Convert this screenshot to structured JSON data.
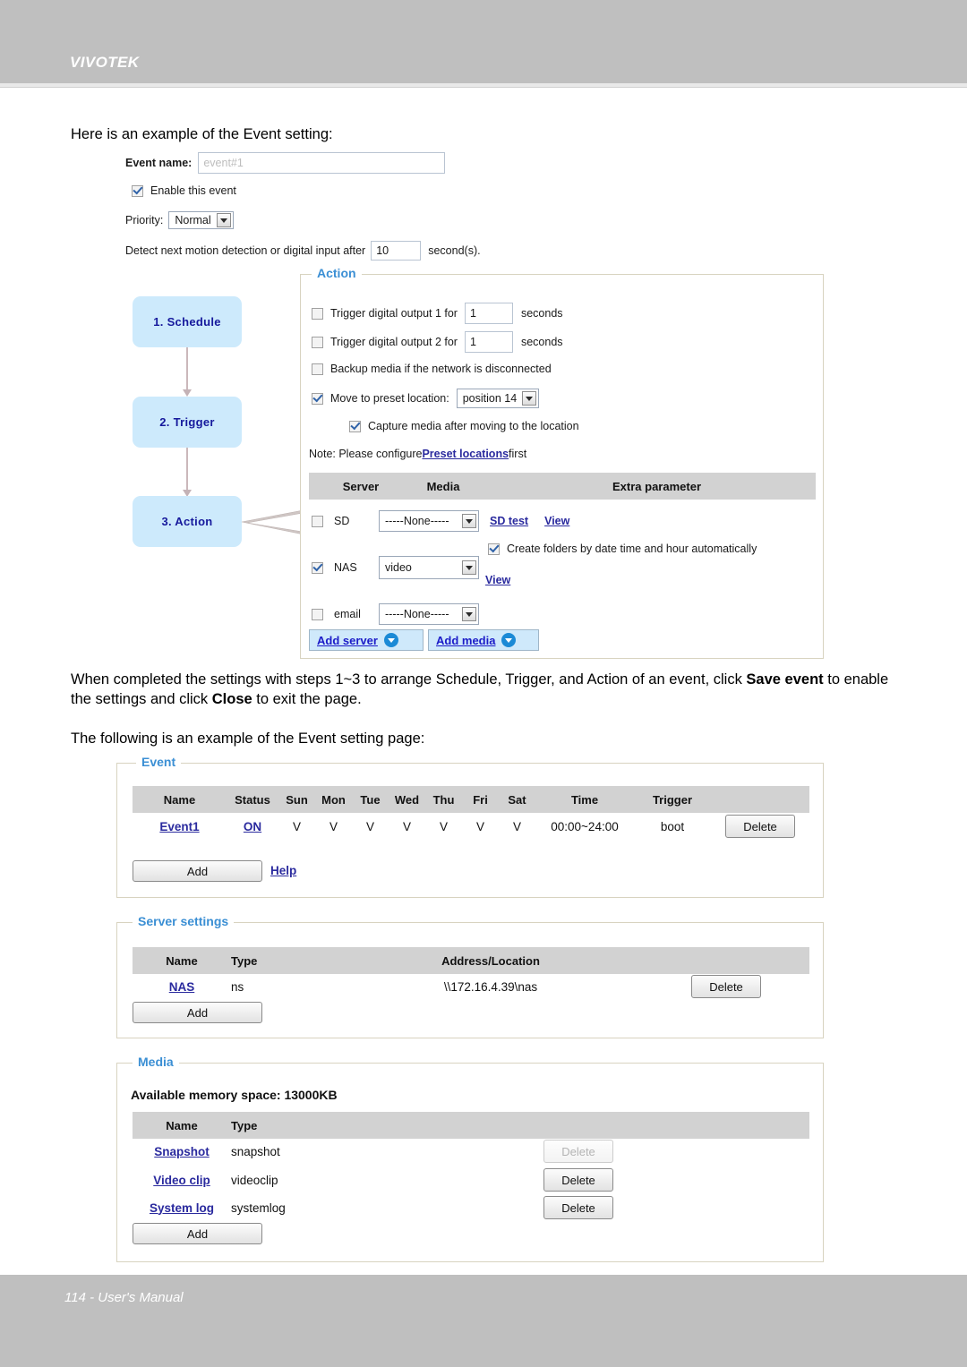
{
  "header": {
    "brand": "VIVOTEK"
  },
  "footer": {
    "text": "114 - User's Manual"
  },
  "body": {
    "intro": "Here is an example of the Event setting:",
    "mid_line1": "When completed the settings with steps 1~3 to arrange Schedule, Trigger, and Action of an event, click",
    "mid_bold1": "Save event",
    "mid_line2a": " to enable the settings and click ",
    "mid_bold2": "Close",
    "mid_line2b": " to exit the page.",
    "follow": "The following is an example of the Event setting page:"
  },
  "event_form": {
    "event_name_label": "Event name:",
    "event_name_placeholder": "event#1",
    "enable_label": "Enable this event",
    "enable_checked": true,
    "priority_label": "Priority:",
    "priority_value": "Normal",
    "detect_label_pre": "Detect next motion detection or digital input after",
    "detect_value": "10",
    "detect_label_post": "second(s)."
  },
  "flow": {
    "steps": [
      {
        "label": "1. Schedule"
      },
      {
        "label": "2. Trigger"
      },
      {
        "label": "3. Action"
      }
    ]
  },
  "action_panel": {
    "legend": "Action",
    "do1_label_pre": "Trigger digital output 1 for",
    "do1_value": "1",
    "do1_label_post": "seconds",
    "do1_checked": false,
    "do2_label_pre": "Trigger digital output 2 for",
    "do2_value": "1",
    "do2_label_post": "seconds",
    "do2_checked": false,
    "backup_label": "Backup media if the network is disconnected",
    "backup_checked": false,
    "preset_label": "Move to preset location:",
    "preset_value": "position 14",
    "preset_checked": true,
    "capture_label": "Capture media after moving to the location",
    "capture_checked": true,
    "note_pre": "Note: Please configure ",
    "note_link": "Preset locations",
    "note_post": " first",
    "table_headers": [
      "",
      "Server",
      "Media",
      "Extra parameter"
    ],
    "rows": [
      {
        "checked": false,
        "server": "SD",
        "media": "-----None-----",
        "extra_links": [
          "SD test",
          "View"
        ],
        "extra_checkbox": null
      },
      {
        "checked": true,
        "server": "NAS",
        "media": "video",
        "extra_checkbox_label": "Create folders by date time and hour automatically",
        "extra_checkbox_checked": true,
        "extra_links": [
          "View"
        ]
      },
      {
        "checked": false,
        "server": "email",
        "media": "-----None-----",
        "extra_links": []
      }
    ],
    "add_server_label": "Add server",
    "add_media_label": "Add media"
  },
  "event_panel": {
    "legend": "Event",
    "headers": [
      "Name",
      "Status",
      "Sun",
      "Mon",
      "Tue",
      "Wed",
      "Thu",
      "Fri",
      "Sat",
      "Time",
      "Trigger"
    ],
    "rows": [
      {
        "name": "Event1",
        "status": "ON",
        "sun": "V",
        "mon": "V",
        "tue": "V",
        "wed": "V",
        "thu": "V",
        "fri": "V",
        "sat": "V",
        "time": "00:00~24:00",
        "trigger": "boot",
        "delete_label": "Delete"
      }
    ],
    "add_label": "Add",
    "help_label": "Help"
  },
  "server_panel": {
    "legend": "Server settings",
    "headers": [
      "Name",
      "Type",
      "Address/Location"
    ],
    "rows": [
      {
        "name": "NAS",
        "type": "ns",
        "address": "\\\\172.16.4.39\\nas",
        "delete_label": "Delete"
      }
    ],
    "add_label": "Add"
  },
  "media_panel": {
    "legend": "Media",
    "memory_label": "Available memory space: 13000KB",
    "headers": [
      "Name",
      "Type"
    ],
    "rows": [
      {
        "name": "Snapshot",
        "type": "snapshot",
        "delete_label": "Delete",
        "delete_disabled": true
      },
      {
        "name": "Video clip",
        "type": "videoclip",
        "delete_label": "Delete",
        "delete_disabled": false
      },
      {
        "name": "System log",
        "type": "systemlog",
        "delete_label": "Delete",
        "delete_disabled": false
      }
    ],
    "add_label": "Add"
  },
  "colors": {
    "header_gray": "#bfbfbf",
    "flow_blue": "#cdeafc",
    "legend_blue": "#3b8fd4",
    "link_blue": "#1b1bc8",
    "table_header_gray": "#d2d2d2",
    "fieldset_border": "#d8d3c0"
  }
}
